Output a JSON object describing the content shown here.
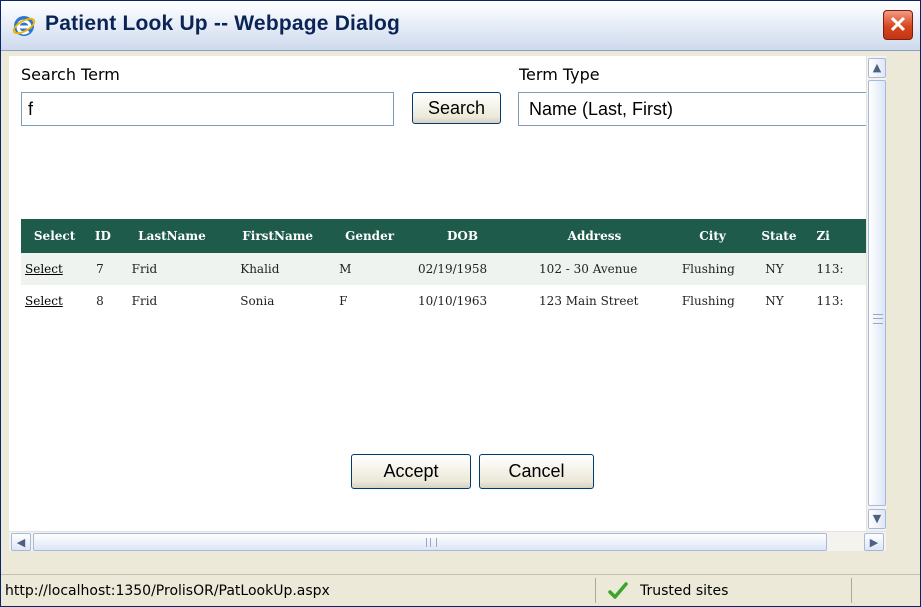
{
  "window": {
    "title": "Patient Look Up -- Webpage Dialog",
    "close_icon": "close-icon"
  },
  "search": {
    "term_label": "Search Term",
    "term_value": "f",
    "search_button": "Search",
    "type_label": "Term Type",
    "type_selected": "Name (Last, First)"
  },
  "grid": {
    "headers": [
      "Select",
      "ID",
      "LastName",
      "FirstName",
      "Gender",
      "DOB",
      "Address",
      "City",
      "State",
      "Zi"
    ],
    "header_bg": "#1e5b4a",
    "rows": [
      {
        "select": "Select",
        "id": "7",
        "last": "Frid",
        "first": "Khalid",
        "gender": "M",
        "dob": "02/19/1958",
        "address": "102 - 30 Avenue",
        "city": "Flushing",
        "state": "NY",
        "zip": "113:"
      },
      {
        "select": "Select",
        "id": "8",
        "last": "Frid",
        "first": "Sonia",
        "gender": "F",
        "dob": "10/10/1963",
        "address": "123 Main Street",
        "city": "Flushing",
        "state": "NY",
        "zip": "113:"
      }
    ]
  },
  "actions": {
    "accept": "Accept",
    "cancel": "Cancel"
  },
  "statusbar": {
    "url": "http://localhost:1350/ProlisOR/PatLookUp.aspx",
    "zone": "Trusted sites",
    "zone_icon": "checkmark-icon"
  }
}
